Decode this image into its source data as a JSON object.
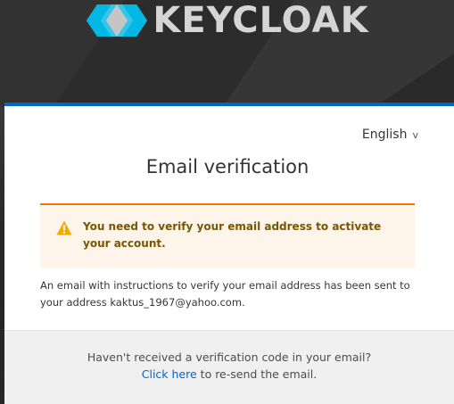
{
  "header": {
    "logo_text": "KEYCLOAK"
  },
  "card": {
    "language": "English",
    "title": "Email verification",
    "alert": {
      "message": "You need to verify your email address to activate your account."
    },
    "info_text": "An email with instructions to verify your email address has been sent to your address kaktus_1967@yahoo.com.",
    "footer": {
      "question": "Haven't received a verification code in your email?",
      "link_text": "Click here",
      "after_link": "to re-send the email."
    }
  },
  "colors": {
    "accent": "#0066cc",
    "warning": "#ec7a08",
    "warning_bg": "#fdf4ea",
    "warning_text": "#795600"
  }
}
